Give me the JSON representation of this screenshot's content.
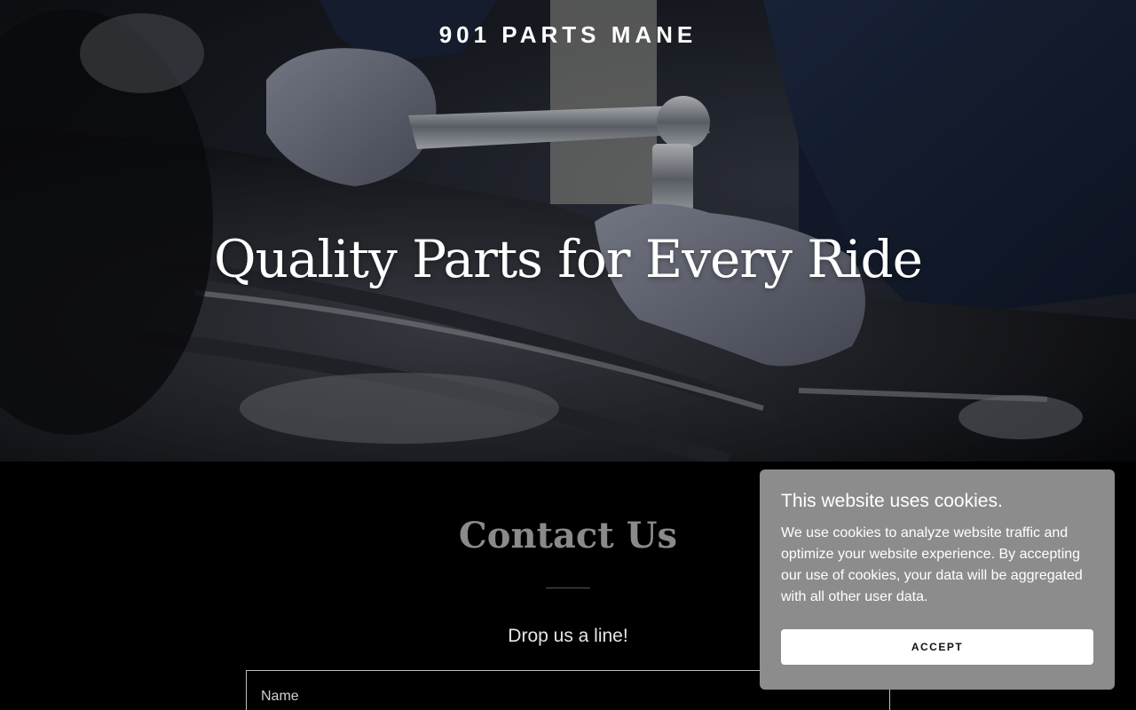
{
  "header": {
    "brand": "901 PARTS MANE"
  },
  "hero": {
    "title": "Quality Parts for Every Ride",
    "image": "mechanic-engine-wrench-photo"
  },
  "contact": {
    "title": "Contact Us",
    "subtitle": "Drop us a line!",
    "name_placeholder": "Name"
  },
  "cookie_banner": {
    "title": "This website uses cookies.",
    "text": "We use cookies to analyze website traffic and optimize your website experience. By accepting our use of cookies, your data will be aggregated with all other user data.",
    "accept_label": "ACCEPT",
    "background_color": "#8c8c8c"
  }
}
